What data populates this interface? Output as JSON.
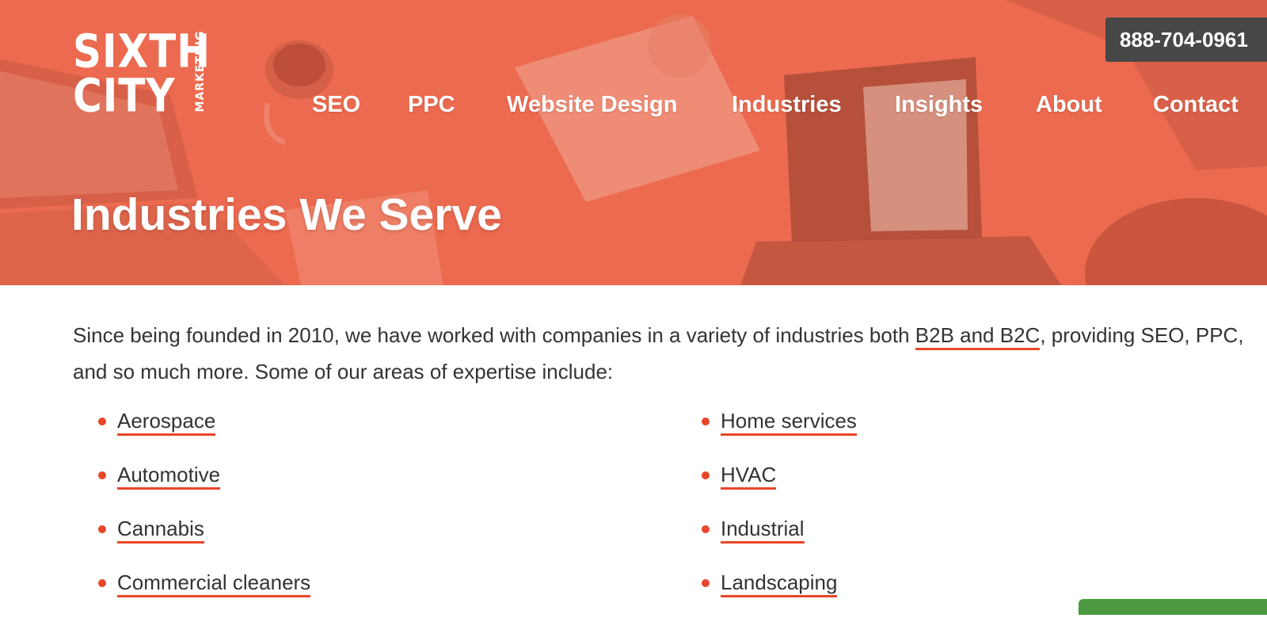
{
  "brand": {
    "logo_line1": "SIXTH",
    "logo_line2": "CITY",
    "logo_side": "MARKETING",
    "accent_color": "#e8462a",
    "hero_color": "#ec6a4f"
  },
  "header": {
    "phone": "888-704-0961",
    "nav": [
      {
        "label": "SEO"
      },
      {
        "label": "PPC"
      },
      {
        "label": "Website Design"
      },
      {
        "label": "Industries"
      },
      {
        "label": "Insights"
      },
      {
        "label": "About"
      },
      {
        "label": "Contact"
      }
    ]
  },
  "hero": {
    "title": "Industries We Serve"
  },
  "main": {
    "intro_before": "Since being founded in 2010, we have worked with companies in a variety of industries both ",
    "intro_link": "B2B and B2C",
    "intro_after": ", providing SEO, PPC, and so much more. Some of our areas of expertise include:",
    "left_list": [
      "Aerospace",
      "Automotive",
      "Cannabis",
      "Commercial cleaners"
    ],
    "right_list": [
      "Home services",
      "HVAC",
      "Industrial",
      "Landscaping"
    ]
  }
}
